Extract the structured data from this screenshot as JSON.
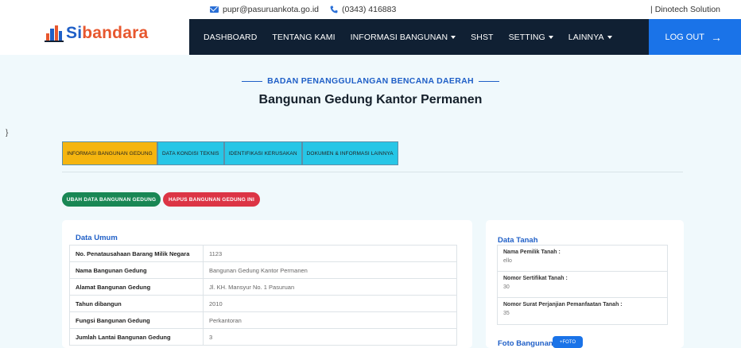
{
  "topbar": {
    "email": "pupr@pasuruankota.go.id",
    "phone": "(0343) 416883",
    "credit": "| Dinotech Solution"
  },
  "brand": {
    "prefix": "Si",
    "name": "bandara"
  },
  "nav": {
    "items": [
      {
        "label": "DASHBOARD",
        "dropdown": false
      },
      {
        "label": "TENTANG KAMI",
        "dropdown": false
      },
      {
        "label": "INFORMASI BANGUNAN",
        "dropdown": true
      },
      {
        "label": "SHST",
        "dropdown": false
      },
      {
        "label": "SETTING",
        "dropdown": true
      },
      {
        "label": "LAINNYA",
        "dropdown": true
      }
    ],
    "logout": "LOG OUT",
    "logout_arrow": "→"
  },
  "header": {
    "subtitle": "BADAN PENANGGULANGAN BENCANA DAERAH",
    "title": "Bangunan Gedung Kantor Permanen"
  },
  "stray_char": "}",
  "tabs": [
    "INFORMASI BANGUNAN GEDUNG",
    "DATA KONDISI TEKNIS",
    "IDENTIFIKASI KERUSAKAN",
    "DOKUMEN & INFORMASI LAINNYA"
  ],
  "actions": {
    "edit": "UBAH DATA BANGUNAN GEDUNG",
    "delete": "HAPUS BANGUNAN GEDUNG INI"
  },
  "data_umum": {
    "title": "Data Umum",
    "rows": [
      {
        "label": "No. Penatausahaan Barang Milik Negara",
        "value": "1123"
      },
      {
        "label": "Nama Bangunan Gedung",
        "value": "Bangunan Gedung Kantor Permanen"
      },
      {
        "label": "Alamat Bangunan Gedung",
        "value": "Jl. KH. Mansyur No. 1 Pasuruan"
      },
      {
        "label": "Tahun dibangun",
        "value": "2010"
      },
      {
        "label": "Fungsi Bangunan Gedung",
        "value": "Perkantoran"
      },
      {
        "label": "Jumlah Lantai Bangunan Gedung",
        "value": "3"
      }
    ]
  },
  "data_tanah": {
    "title": "Data Tanah",
    "rows": [
      {
        "label": "Nama Pemilik Tanah :",
        "value": "ello"
      },
      {
        "label": "Nomor Sertifikat Tanah :",
        "value": "30"
      },
      {
        "label": "Nomor Surat Perjanjian Pemanfaatan Tanah :",
        "value": "35"
      }
    ]
  },
  "foto": {
    "title": "Foto Bangunan",
    "button": "+FOTO"
  }
}
